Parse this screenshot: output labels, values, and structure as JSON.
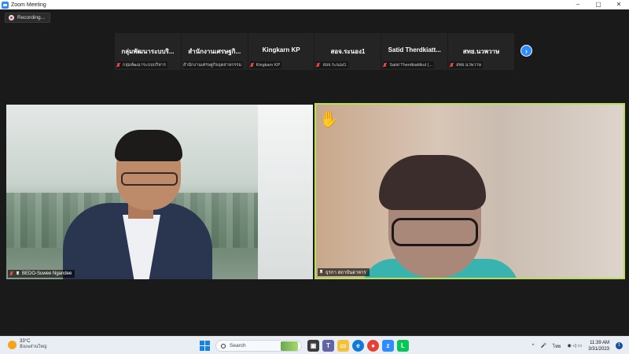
{
  "window": {
    "title": "Zoom Meeting",
    "controls": [
      "–",
      "▢",
      "✕"
    ]
  },
  "recording": {
    "label": "Recording..."
  },
  "participants_strip": [
    {
      "display_name": "กลุ่มพัฒนาระบบริ...",
      "label": "กลุ่มพัฒนาระบบบริหาร"
    },
    {
      "display_name": "สำนักงานเศรษฐกิ...",
      "label": "สำนักงานเศรษฐกิจอุตสาหกรรม"
    },
    {
      "display_name": "Kingkarn KP",
      "label": "Kingkarn KP"
    },
    {
      "display_name": "สอจ.ระนอง1",
      "label": "สอจ.ระนอง1"
    },
    {
      "display_name": "Satid Therdkiatt...",
      "label": "Satid Therdkiattikul (..."
    },
    {
      "display_name": "สทย.นวพวาษ",
      "label": "สทย.นวพวาษ"
    }
  ],
  "next_page_icon": "chevron-right-icon",
  "videos": {
    "left": {
      "name": "BEDO-Suwee Ngandee"
    },
    "right": {
      "name": "ธุรกา สถาบันอาหาร",
      "reaction": "✋"
    }
  },
  "taskbar": {
    "weather": {
      "temp": "33°C",
      "condition": "มีเมฆส่วนใหญ่"
    },
    "search_placeholder": "Search",
    "language": "ไทย",
    "time": "11:39 AM",
    "date": "3/31/2023",
    "notifications": "1",
    "accent": "#1583e3"
  }
}
